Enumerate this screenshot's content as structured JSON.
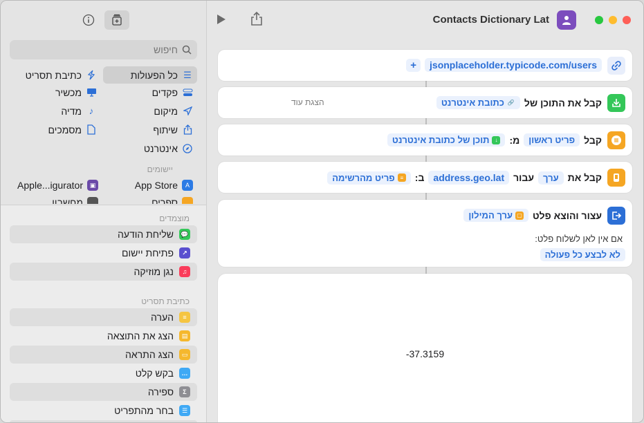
{
  "window": {
    "title": "Contacts Dictionary Lat"
  },
  "sidebar": {
    "search_placeholder": "חיפוש",
    "categories_right": [
      {
        "label": "כל הפעולות",
        "icon": "list-icon",
        "selected": true
      },
      {
        "label": "פקדים",
        "icon": "toggle-icon"
      },
      {
        "label": "מיקום",
        "icon": "location-arrow-icon"
      },
      {
        "label": "שיתוף",
        "icon": "share-icon"
      },
      {
        "label": "אינטרנט",
        "icon": "compass-icon"
      }
    ],
    "categories_left": [
      {
        "label": "כתיבת תסריט",
        "icon": "script-icon"
      },
      {
        "label": "מכשיר",
        "icon": "monitor-icon"
      },
      {
        "label": "מדיה",
        "icon": "music-note-icon"
      },
      {
        "label": "מסמכים",
        "icon": "document-icon"
      }
    ],
    "apps_label": "יישומים",
    "apps": [
      {
        "label": "App Store",
        "icon": "app-store-icon",
        "color": "#2c7be5"
      },
      {
        "label": "Apple...igurator",
        "icon": "configurator-icon",
        "color": "#6b4aa8"
      }
    ],
    "apps_partial": [
      "ספרים",
      "מחשבון"
    ],
    "suggested_label": "מוצמדים",
    "suggested": [
      {
        "label": "שליחת הודעה",
        "icon": "message-icon",
        "color": "#34c759"
      },
      {
        "label": "פתיחת יישום",
        "icon": "open-app-icon",
        "color": "#5a4fcf"
      },
      {
        "label": "נגן מוזיקה",
        "icon": "music-icon",
        "color": "#fa3c5a"
      }
    ],
    "scripting_label": "כתיבת תסריט",
    "scripting": [
      {
        "label": "הערה",
        "icon": "comment-lines-icon",
        "color": "#f5c542"
      },
      {
        "label": "הצג את התוצאה",
        "icon": "show-result-icon",
        "color": "#f5b82e"
      },
      {
        "label": "הצג התראה",
        "icon": "alert-icon",
        "color": "#f5b82e"
      },
      {
        "label": "בקש קלט",
        "icon": "ask-input-icon",
        "color": "#3fa9f5"
      },
      {
        "label": "ספירה",
        "icon": "sigma-icon",
        "color": "#8e8e93"
      },
      {
        "label": "בחר מהתפריט",
        "icon": "menu-icon",
        "color": "#3fa9f5"
      }
    ]
  },
  "actions": {
    "url": {
      "value": "jsonplaceholder.typicode.com/users",
      "plus": "+"
    },
    "get_contents": {
      "label": "קבל את התוכן של",
      "token": "כתובת אינטרנט",
      "more": "הצגת עוד"
    },
    "get_item": {
      "label": "קבל",
      "token1": "פריט ראשון",
      "from": "מ:",
      "token2": "תוכן של כתובת אינטרנט"
    },
    "get_value": {
      "label": "קבל את",
      "token1": "ערך",
      "for": "עבור",
      "key": "address.geo.lat",
      "in": "ב:",
      "token2": "פריט מהרשימה"
    },
    "stop_output": {
      "label": "עצור והוצא פלט",
      "token": "ערך המילון",
      "if_none": "אם אין לאן לשלוח פלט:",
      "do_nothing": "לא לבצע כל פעולה"
    }
  },
  "result": {
    "value": "-37.3159"
  }
}
